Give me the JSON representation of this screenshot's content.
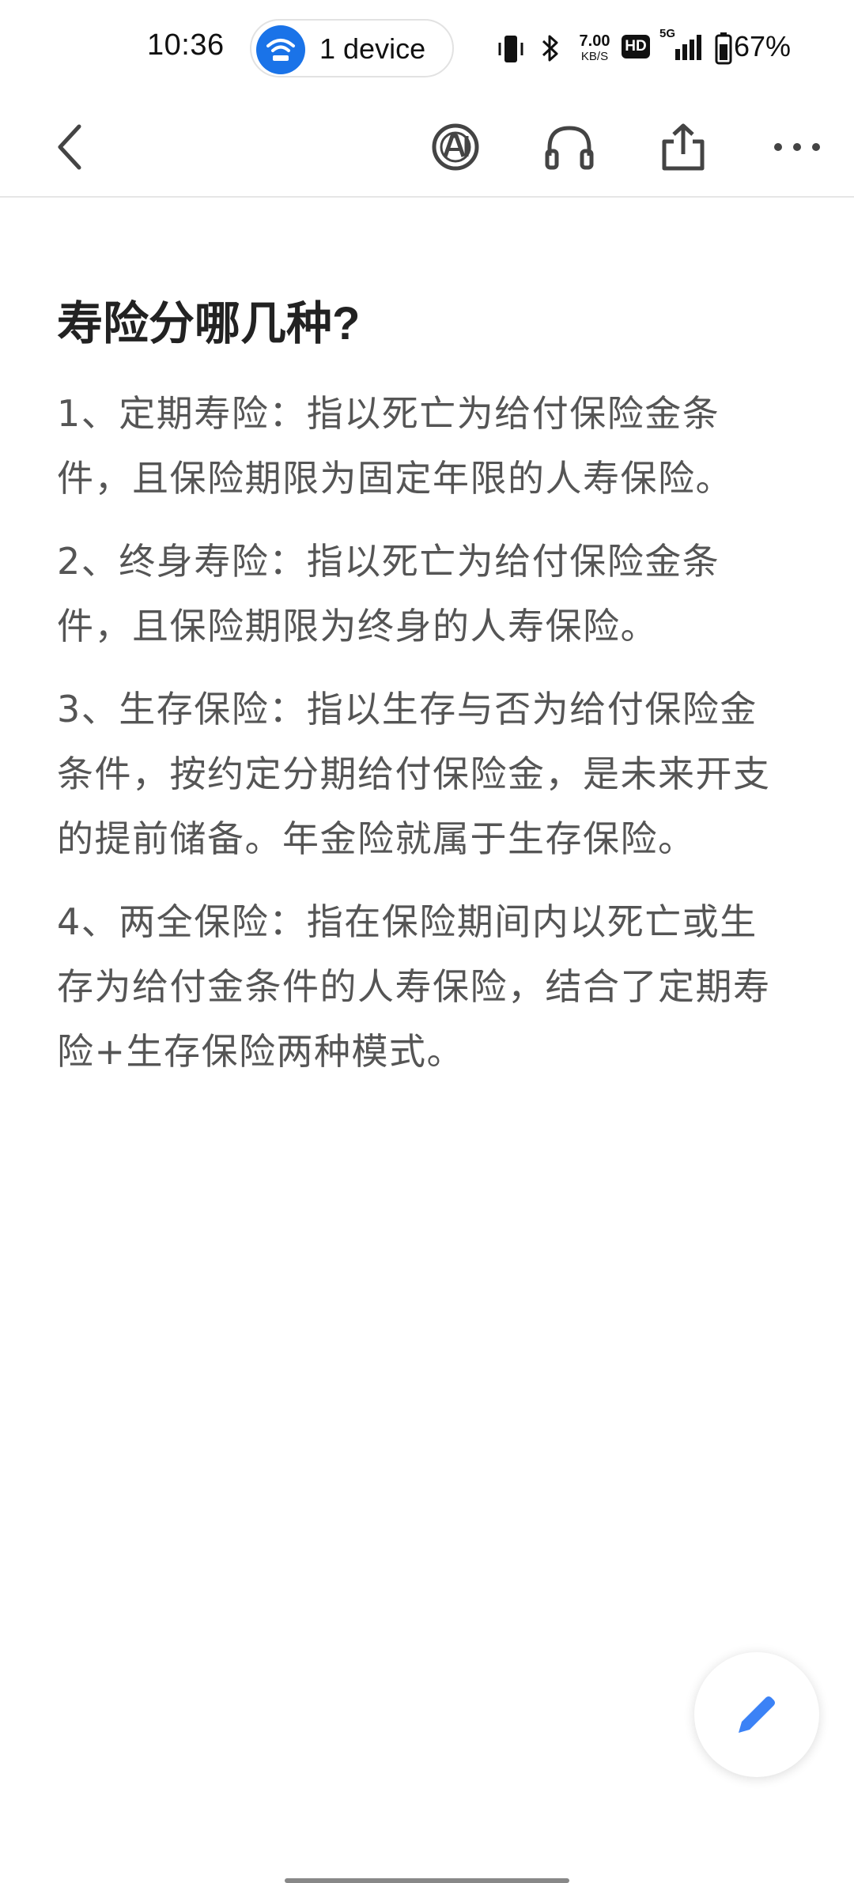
{
  "status_bar": {
    "time": "10:36",
    "device_pill": {
      "label": "1 device",
      "icon": "wifi-icon",
      "accent": "#1a73e8"
    },
    "net_speed_value": "7.00",
    "net_speed_unit": "KB/S",
    "hd_badge": "HD",
    "network": "5G",
    "battery_percent": "67%"
  },
  "toolbar": {
    "back_icon": "chevron-left-icon",
    "ai_icon": "ai-icon",
    "listen_icon": "headphones-icon",
    "share_icon": "share-icon",
    "more_icon": "more-dots-icon"
  },
  "article": {
    "title": "寿险分哪几种?",
    "paragraphs": [
      "1、定期寿险：指以死亡为给付保险金条件，且保险期限为固定年限的人寿保险。",
      "2、终身寿险：指以死亡为给付保险金条件，且保险期限为终身的人寿保险。",
      "3、生存保险：指以生存与否为给付保险金条件，按约定分期给付保险金，是未来开支的提前储备。年金险就属于生存保险。",
      "4、两全保险：指在保险期间内以死亡或生存为给付金条件的人寿保险，结合了定期寿险+生存保险两种模式。"
    ]
  },
  "fab": {
    "icon": "pencil-icon",
    "color": "#3b82f6"
  }
}
